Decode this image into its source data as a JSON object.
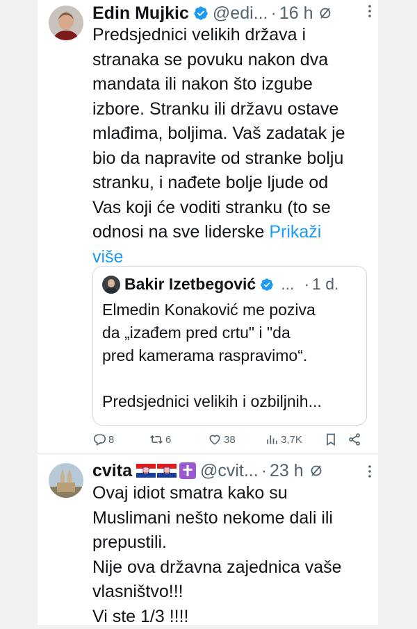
{
  "tweet1": {
    "author_name": "Edin Mujkic",
    "handle": "@edi...",
    "time": "16 h",
    "body": "Predsjednici velikih država i\nstranaka se povuku nakon dva\nmandata ili nakon što izgube\nizbore. Stranku ili državu ostave\nmlađima, boljima. Vaš zadatak je\nbio da napravite od stranke bolju\nstranku, i nađete bolje ljude od\nVas koji će voditi stranku (to se\nodnosi na sve liderske ",
    "show_more": "Prikaži\nviše",
    "quote": {
      "author_name": "Bakir Izetbegović",
      "handle": "...",
      "time": "1 d.",
      "body": "Elmedin Konaković me poziva\nda „izađem pred crtu\" i \"da\npred kamerama raspravimo“.\n\nPredsjednici velikih i ozbiljnih..."
    },
    "actions": {
      "replies": "8",
      "reposts": "6",
      "likes": "38",
      "views": "3,7K"
    }
  },
  "tweet2": {
    "author_name": "cvita",
    "handle": "@cvit...",
    "time": "23 h",
    "body": "Ovaj idiot smatra kako su\nMuslimani nešto nekome dali ili\nprepustili.\nNije ova državna zajednica vaše\nvlasništvo!!!\nVi ste 1/3 !!!!"
  },
  "colors": {
    "link": "#1d9bf0",
    "verified": "#1d9bf0",
    "meta": "#536471"
  },
  "icons": [
    "verified-badge",
    "grok-icon",
    "more-icon",
    "reply-icon",
    "repost-icon",
    "like-icon",
    "views-icon",
    "bookmark-icon",
    "share-icon",
    "flag-croatia-icon",
    "cross-icon"
  ]
}
